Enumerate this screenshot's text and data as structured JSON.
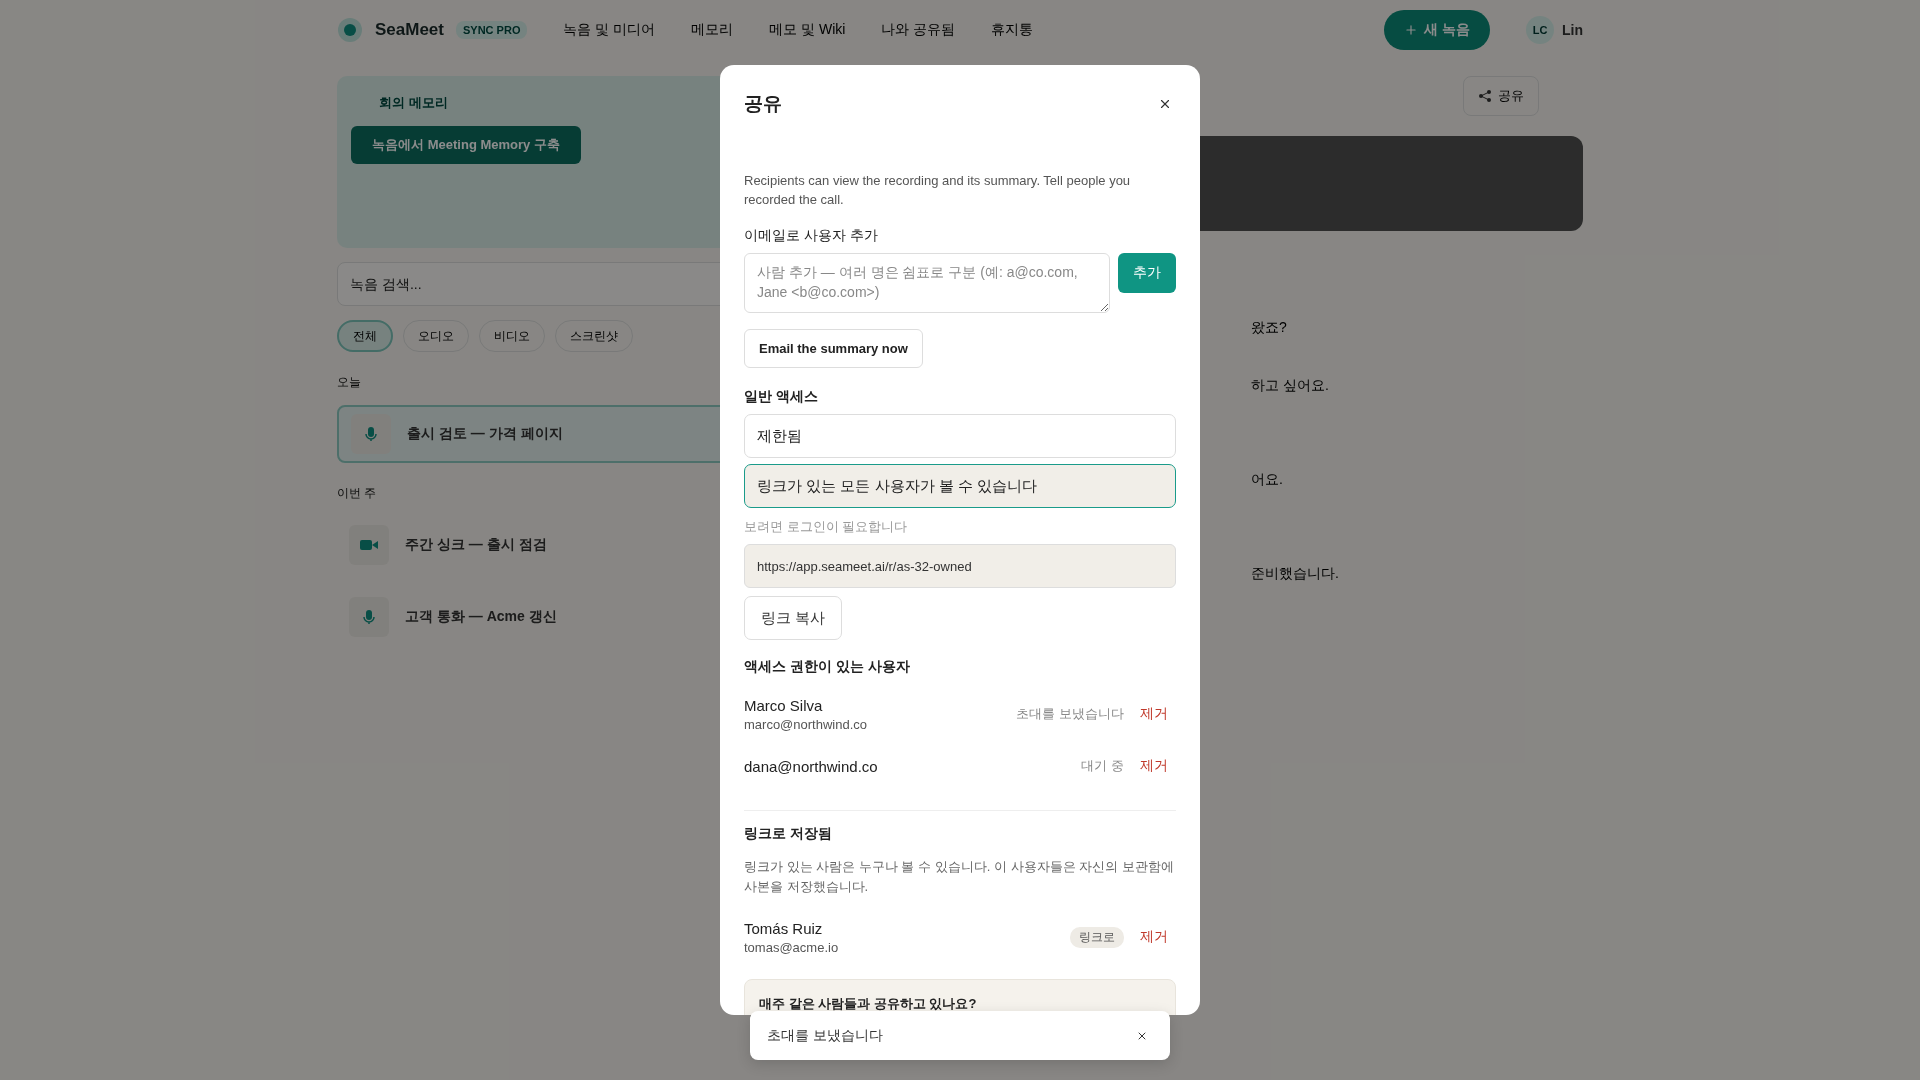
{
  "nav": {
    "brand": "SeaMeet",
    "plan": "SYNC PRO",
    "links": [
      {
        "label": "녹음 및 미디어",
        "selected": false
      },
      {
        "label": "메모리",
        "selected": false
      },
      {
        "label": "메모 및 Wiki",
        "selected": false
      },
      {
        "label": "나와 공유됨",
        "selected": false
      },
      {
        "label": "휴지통",
        "selected": false
      }
    ],
    "new_button": "새 녹음",
    "avatar": "LC",
    "user": "Lin"
  },
  "memory_card": {
    "title": "회의 메모리",
    "button": "녹음에서 Meeting Memory 구축"
  },
  "search": {
    "placeholder": "녹음 검색..."
  },
  "filters": [
    {
      "label": "전체",
      "selected": true
    },
    {
      "label": "오디오",
      "selected": false
    },
    {
      "label": "비디오",
      "selected": false
    },
    {
      "label": "스크린샷",
      "selected": false
    }
  ],
  "groups": [
    {
      "label": "오늘",
      "items": [
        {
          "title": "출시 검토 — 가격 페이지",
          "kind": "audio",
          "selected": true
        }
      ]
    },
    {
      "label": "이번 주",
      "items": [
        {
          "title": "주간 싱크 — 출시 점검",
          "kind": "video",
          "selected": false
        },
        {
          "title": "고객 통화 — Acme 갱신",
          "kind": "audio",
          "selected": false
        }
      ]
    }
  ],
  "detail": {
    "share_button": "공유",
    "transcript": [
      "왔죠?",
      "하고 싶어요.",
      "어요.",
      "준비했습니다."
    ]
  },
  "dialog": {
    "title": "공유",
    "intro": "Recipients can view the recording and its summary. Tell people you recorded the call.",
    "add_label": "이메일로 사용자 추가",
    "add_placeholder": "사람 추가 — 여러 명은 쉼표로 구분 (예: a@co.com, Jane <b@co.com>)",
    "add_button": "추가",
    "email_button": "Email the summary now",
    "general_label": "일반 액세스",
    "access_options": [
      {
        "label": "제한됨",
        "selected": false
      },
      {
        "label": "링크가 있는 모든 사용자가 볼 수 있습니다",
        "selected": true
      }
    ],
    "access_hint": "보려면 로그인이 필요합니다",
    "link": "https://app.seameet.ai/r/as-32-owned",
    "copy_button": "링크 복사",
    "people_label": "액세스 권한이 있는 사용자",
    "people": [
      {
        "name": "Marco Silva",
        "email": "marco@northwind.co",
        "status": "초대를 보냈습니다",
        "remove": "제거"
      },
      {
        "email": "dana@northwind.co",
        "status": "대기 중",
        "remove": "제거"
      }
    ],
    "saved_label": "링크로 저장됨",
    "saved_text": "링크가 있는 사람은 누구나 볼 수 있습니다. 이 사용자들은 자신의 보관함에 사본을 저장했습니다.",
    "saved": [
      {
        "name": "Tomás Ruiz",
        "email": "tomas@acme.io",
        "tag": "링크로",
        "remove": "제거"
      }
    ],
    "tip_title": "매주 같은 사람들과 공유하고 있나요?"
  },
  "toast": {
    "text": "초대를 보냈습니다"
  }
}
